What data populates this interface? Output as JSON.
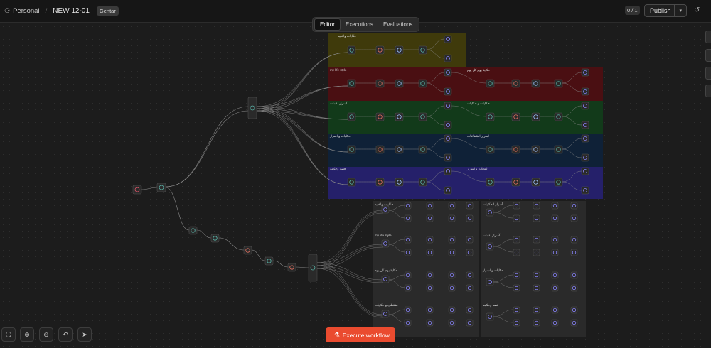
{
  "header": {
    "project": "Personal",
    "workflow_name": "NEW 12-01",
    "tag": "Gentar",
    "counter": "0 / 1",
    "publish_label": "Publish"
  },
  "tabs": [
    {
      "label": "Editor",
      "active": true
    },
    {
      "label": "Executions",
      "active": false
    },
    {
      "label": "Evaluations",
      "active": false
    }
  ],
  "groups": {
    "top_left": [
      "حکایات واقعیه",
      "my life style",
      "آسرار لقمات",
      "حکایات و اسرار",
      "قصه وحکمه"
    ],
    "top_right": [
      "حکایة یوم کل یوم",
      "حکایات و حکایات",
      "اسرار الشفاعات",
      "لقطات و اسرار"
    ],
    "bottom_left": [
      "حکایات واقعیه",
      "my life style",
      "حکایة یوم کل یوم",
      "مقتطف و حکایات"
    ],
    "bottom_right": [
      "آسرار الحکایات",
      "آسرار لقمات",
      "حکایات و اسرار",
      "قصه وحکمه"
    ]
  },
  "colors": {
    "accent": "#ea4b2f",
    "sticky_yellow": "#3f3a0b",
    "sticky_red": "#4a0f12",
    "sticky_green": "#123a1a",
    "sticky_blue": "#0f2137",
    "sticky_purple": "#25206a",
    "node_bg": "#2a2a2a",
    "node_border": "#555555",
    "connection": "#8a8a8a"
  },
  "footer": {
    "execute_label": "Execute workflow"
  },
  "icons": {
    "fit": "fit-view-icon",
    "zoom_in": "zoom-in-icon",
    "zoom_out": "zoom-out-icon",
    "undo": "undo-icon",
    "select": "cursor-icon",
    "flask": "flask-icon",
    "history": "history-icon",
    "person": "person-icon"
  }
}
